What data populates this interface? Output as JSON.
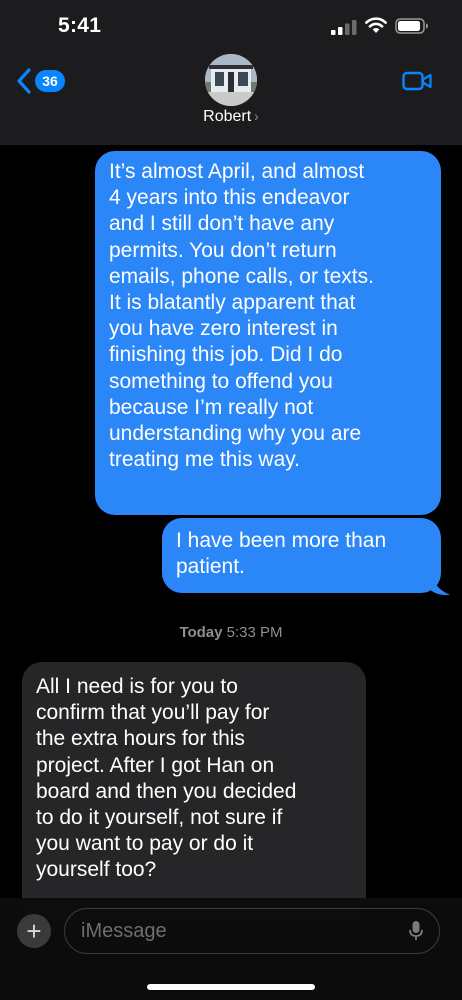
{
  "status_bar": {
    "time": "5:41"
  },
  "nav": {
    "back_count": "36",
    "contact_name": "Robert",
    "contact_chevron": "›"
  },
  "messages": [
    {
      "direction": "sent",
      "text": "It’s almost April, and almost\n4 years into this endeavor\nand I still don’t have any\npermits.  You don’t return\nemails, phone calls, or texts.\nIt is blatantly apparent that\nyou have zero interest in\nfinishing this job.  Did I do\nsomething to offend you\nbecause I’m really not\nunderstanding why you are\ntreating me this way."
    },
    {
      "direction": "sent",
      "text": "I have been more than\npatient."
    },
    {
      "direction": "received",
      "text": "All I need is for you to\nconfirm that you’ll pay for\nthe extra hours for this\nproject. After I got Han on\nboard and then you decided\nto do it yourself, not sure if\nyou want to pay or do it\nyourself too?"
    }
  ],
  "timestamp": {
    "day": "Today",
    "time": "5:33 PM"
  },
  "composer": {
    "placeholder": "iMessage",
    "plus_label": "+"
  },
  "colors": {
    "sent_bubble": "#2b86f7",
    "received_bubble": "#262629",
    "accent": "#0a84ff",
    "header_bg": "#1c1c1e"
  }
}
